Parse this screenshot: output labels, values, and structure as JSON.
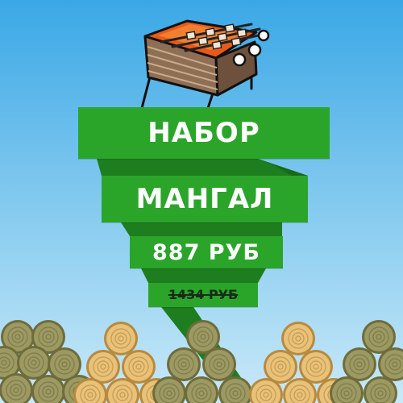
{
  "title_line1": "НАБОР",
  "title_line2": "МАНГАЛ",
  "price": "887 РУБ",
  "old_price": "1434 РУБ",
  "colors": {
    "sky_top": "#3aa8e6",
    "sky_bottom": "#c9e9f8",
    "ribbon_green": "#2aa52a",
    "ribbon_dark": "#1e7d1e",
    "log_fresh": "#e8c27a",
    "log_aged": "#9c9a62",
    "coals": "#e85a1a"
  },
  "icons": [
    "grill-icon",
    "firewood-logs"
  ]
}
